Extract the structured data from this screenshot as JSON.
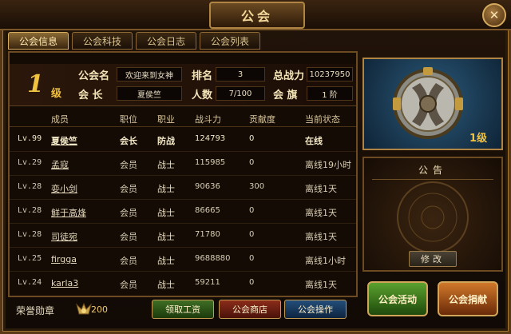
{
  "window": {
    "title": "公会",
    "close_symbol": "✕"
  },
  "tabs": [
    {
      "label": "公会信息",
      "active": true
    },
    {
      "label": "公会科技",
      "active": false
    },
    {
      "label": "公会日志",
      "active": false
    },
    {
      "label": "公会列表",
      "active": false
    }
  ],
  "guild_info": {
    "level_num": "1",
    "level_unit": "级",
    "name_label": "公会名",
    "name_value": "欢迎来到女神",
    "rank_label": "排名",
    "rank_value": "3",
    "power_label": "总战力",
    "power_value": "10237950",
    "leader_label": "会 长",
    "leader_value": "夏侯竺",
    "members_label": "人数",
    "members_value": "7/100",
    "flag_label": "会 旗",
    "flag_value": "1 阶"
  },
  "table": {
    "headers": [
      "成员",
      "职位",
      "职业",
      "战斗力",
      "贡献度",
      "当前状态"
    ],
    "rows": [
      {
        "level": "Lv.99",
        "name": "夏侯竺",
        "position": "会长",
        "job": "防战",
        "power": "124793",
        "contribution": "0",
        "status": "在线"
      },
      {
        "level": "Lv.29",
        "name": "孟寇",
        "position": "会员",
        "job": "战士",
        "power": "115985",
        "contribution": "0",
        "status": "离线19小时"
      },
      {
        "level": "Lv.28",
        "name": "娈小剑",
        "position": "会员",
        "job": "战士",
        "power": "90636",
        "contribution": "300",
        "status": "离线1天"
      },
      {
        "level": "Lv.28",
        "name": "鲜于高烽",
        "position": "会员",
        "job": "战士",
        "power": "86665",
        "contribution": "0",
        "status": "离线1天"
      },
      {
        "level": "Lv.28",
        "name": "司徒宛",
        "position": "会员",
        "job": "战士",
        "power": "71780",
        "contribution": "0",
        "status": "离线1天"
      },
      {
        "level": "Lv.25",
        "name": "firgga",
        "position": "会员",
        "job": "战士",
        "power": "9688880",
        "contribution": "0",
        "status": "离线1小时"
      },
      {
        "level": "Lv.24",
        "name": "karla3",
        "position": "会员",
        "job": "战士",
        "power": "59211",
        "contribution": "0",
        "status": "离线1天"
      }
    ]
  },
  "bottom": {
    "honor_label": "荣誉勋章",
    "honor_value": "200",
    "collect_salary": "领取工资",
    "guild_shop": "公会商店",
    "guild_ops": "公会操作"
  },
  "emblem": {
    "level": "1级"
  },
  "notice": {
    "title": "公告",
    "edit_label": "修改"
  },
  "actions": {
    "activity": "公会活动",
    "donate": "公会捐献"
  },
  "colors": {
    "gold": "#f0c240",
    "frame": "#b08543",
    "panel": "#140b05"
  }
}
